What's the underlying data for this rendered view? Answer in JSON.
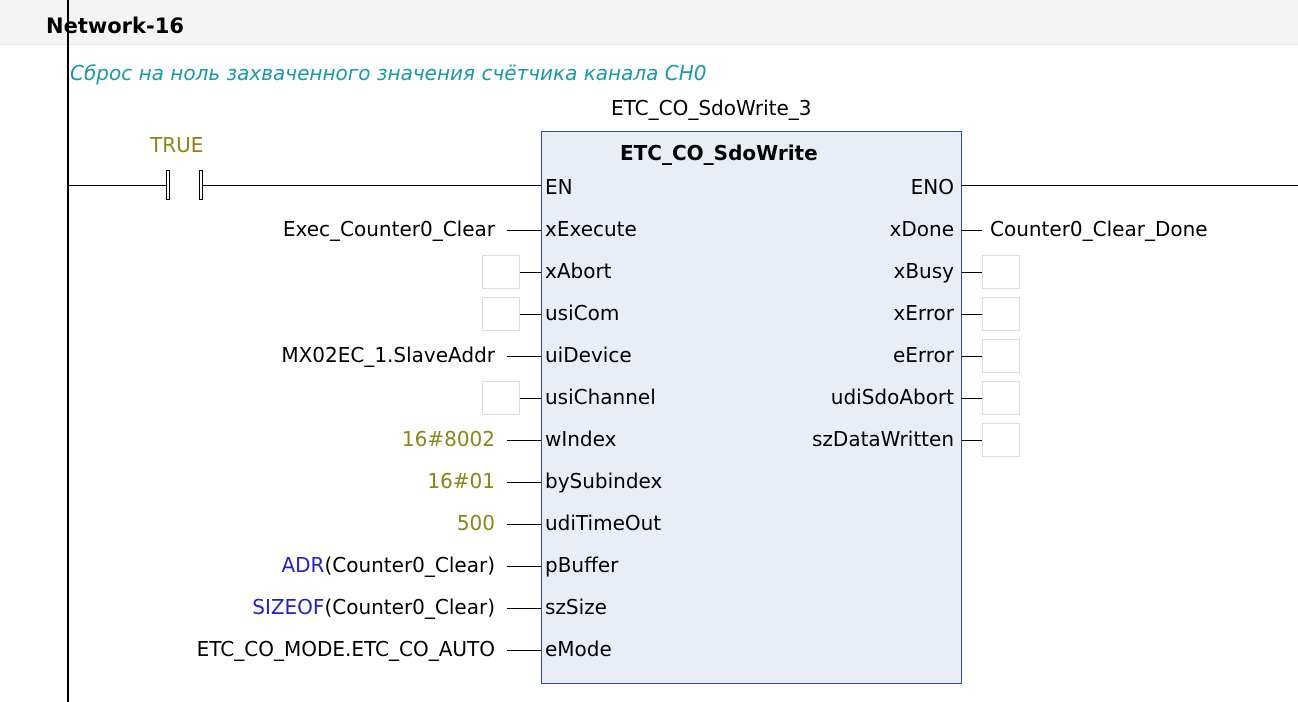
{
  "network": {
    "title": "Network-16",
    "comment": "Сброс на ноль захваченного значения счётчика канала CH0"
  },
  "contact": {
    "label": "TRUE"
  },
  "block": {
    "instance_name": "ETC_CO_SdoWrite_3",
    "type_name": "ETC_CO_SdoWrite",
    "inputs": [
      "EN",
      "xExecute",
      "xAbort",
      "usiCom",
      "uiDevice",
      "usiChannel",
      "wIndex",
      "bySubindex",
      "udiTimeOut",
      "pBuffer",
      "szSize",
      "eMode"
    ],
    "outputs": [
      "ENO",
      "xDone",
      "xBusy",
      "xError",
      "eError",
      "udiSdoAbort",
      "szDataWritten"
    ]
  },
  "input_vars": {
    "xExecute": "Exec_Counter0_Clear",
    "uiDevice": "MX02EC_1.SlaveAddr",
    "wIndex": "16#8002",
    "bySubindex": "16#01",
    "udiTimeOut": "500",
    "pBuffer_fn": "ADR",
    "pBuffer_arg": "(Counter0_Clear)",
    "szSize_fn": "SIZEOF",
    "szSize_arg": "(Counter0_Clear)",
    "eMode": "ETC_CO_MODE.ETC_CO_AUTO"
  },
  "output_vars": {
    "xDone": "Counter0_Clear_Done"
  }
}
